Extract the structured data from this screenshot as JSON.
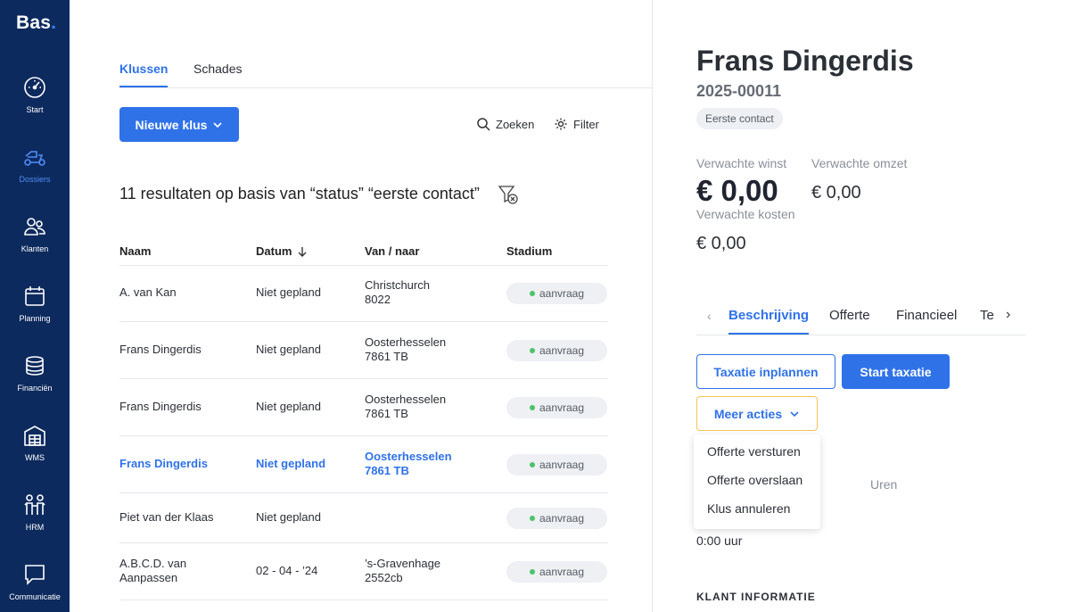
{
  "brand": {
    "name": "Bas",
    "dot": "."
  },
  "sidebar": {
    "items": [
      {
        "label": "Start",
        "icon": "speedometer-icon"
      },
      {
        "label": "Dossiers",
        "icon": "scooter-icon"
      },
      {
        "label": "Klanten",
        "icon": "users-icon"
      },
      {
        "label": "Planning",
        "icon": "calendar-icon"
      },
      {
        "label": "Financiën",
        "icon": "coins-icon"
      },
      {
        "label": "WMS",
        "icon": "warehouse-icon"
      },
      {
        "label": "HRM",
        "icon": "people-icon"
      },
      {
        "label": "Communicatie",
        "icon": "chat-icon"
      }
    ]
  },
  "main": {
    "tabs": [
      {
        "label": "Klussen"
      },
      {
        "label": "Schades"
      }
    ],
    "new_button": "Nieuwe klus",
    "search_label": "Zoeken",
    "filter_label": "Filter",
    "results_text": "11 resultaten op basis van “status” “eerste contact”",
    "columns": {
      "name": "Naam",
      "date": "Datum",
      "route": "Van / naar",
      "stage": "Stadium"
    },
    "rows": [
      {
        "name": "A. van Kan",
        "date": "Niet gepland",
        "route1": "Christchurch",
        "route2": "8022",
        "stage": "aanvraag"
      },
      {
        "name": "Frans Dingerdis",
        "date": "Niet gepland",
        "route1": "Oosterhesselen",
        "route2": "7861 TB",
        "stage": "aanvraag"
      },
      {
        "name": "Frans Dingerdis",
        "date": "Niet gepland",
        "route1": "Oosterhesselen",
        "route2": "7861 TB",
        "stage": "aanvraag"
      },
      {
        "name": "Frans Dingerdis",
        "date": "Niet gepland",
        "route1": "Oosterhesselen",
        "route2": "7861 TB",
        "stage": "aanvraag"
      },
      {
        "name": "Piet van der Klaas",
        "date": "Niet gepland",
        "route1": "",
        "route2": "",
        "stage": "aanvraag"
      },
      {
        "name1": "A.B.C.D. van",
        "name2": "Aanpassen",
        "date": "02 - 04 - ’24",
        "route1": "’s-Gravenhage",
        "route2": "2552cb",
        "stage": "aanvraag"
      }
    ]
  },
  "panel": {
    "title": "Frans Dingerdis",
    "number": "2025-00011",
    "status": "Eerste contact",
    "expected_profit_label": "Verwachte winst",
    "expected_profit": "€ 0,00",
    "expected_revenue_label": "Verwachte omzet",
    "expected_revenue": "€ 0,00",
    "expected_costs_label": "Verwachte kosten",
    "expected_costs": "€ 0,00",
    "tabs": [
      {
        "label": "Beschrijving"
      },
      {
        "label": "Offerte"
      },
      {
        "label": "Financieel"
      },
      {
        "label": "Te"
      }
    ],
    "btn_schedule": "Taxatie inplannen",
    "btn_start": "Start taxatie",
    "btn_more": "Meer acties",
    "dropdown": [
      "Offerte versturen",
      "Offerte overslaan",
      "Klus annuleren"
    ],
    "hours_label": "Uren",
    "hours_value": "0:00 uur",
    "section_title": "KLANT INFORMATIE"
  }
}
